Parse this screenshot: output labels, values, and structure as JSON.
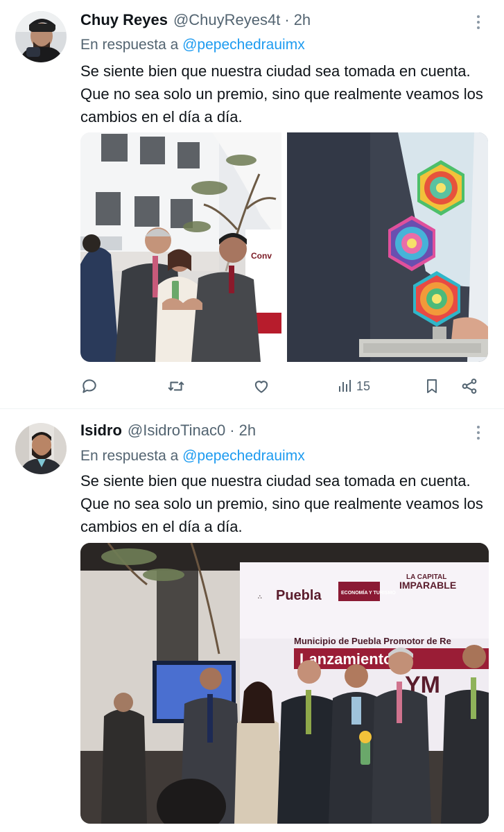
{
  "tweets": [
    {
      "display_name": "Chuy Reyes",
      "handle": "@ChuyReyes4t",
      "separator": "·",
      "time": "2h",
      "reply_prefix": "En respuesta a",
      "reply_handle": "@pepechedrauimx",
      "text": "Se siente bien que nuestra ciudad sea tomada en cuenta. Que no sea solo un premio, sino que realmente veamos los cambios en el día a día.",
      "views": "15"
    },
    {
      "display_name": "Isidro",
      "handle": "@IsidroTinac0",
      "separator": "·",
      "time": "2h",
      "reply_prefix": "En respuesta a",
      "reply_handle": "@pepechedrauimx",
      "text": "Se siente bien que nuestra ciudad sea tomada en cuenta. Que no sea solo un premio, sino que realmente veamos los cambios en el día a día."
    }
  ],
  "media_text": {
    "puebla": "Puebla",
    "economia": "ECONOMÍA Y TURISMO",
    "capital": "LA CAPITAL",
    "imparable": "IMPARABLE",
    "banner": "Municipio de Puebla Promotor de Re",
    "lanzamiento": "Lanzamiento d",
    "ym": "YM"
  },
  "colors": {
    "text": "#0f1419",
    "secondary": "#536471",
    "link": "#1d9bf0",
    "divider": "#eff3f4"
  },
  "icons": [
    "reply-icon",
    "retweet-icon",
    "like-icon",
    "views-icon",
    "bookmark-icon",
    "share-icon",
    "more-icon"
  ]
}
